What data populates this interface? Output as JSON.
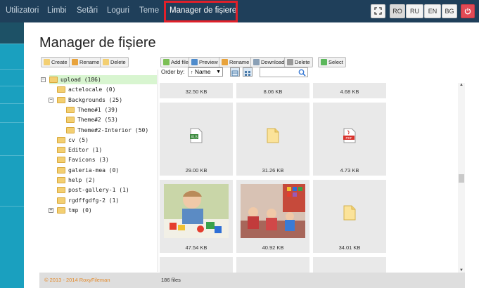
{
  "nav": {
    "items": [
      "Utilizatori",
      "Limbi",
      "Setări",
      "Loguri",
      "Teme",
      "Manager de fișiere"
    ],
    "languages": [
      "RO",
      "RU",
      "EN",
      "BG"
    ],
    "selected_language": "RO",
    "expand_icon": "expand-icon",
    "power_icon": "power-icon",
    "colors": {
      "nav_bg": "#1f3f5a",
      "highlight_border": "#e0202a",
      "sidebar": "#1aa0bf"
    }
  },
  "page": {
    "title": "Manager de fișiere"
  },
  "tree_toolbar": {
    "create": "Create",
    "rename": "Rename",
    "delete": "Delete"
  },
  "file_toolbar": {
    "add_file": "Add file",
    "preview": "Preview",
    "rename": "Rename",
    "download": "Download",
    "delete": "Delete",
    "select": "Select",
    "order_by_label": "Order by:",
    "order_by_value": "Name"
  },
  "tree": [
    {
      "label": "upload (186)",
      "level": 0,
      "expander": "−",
      "selected": true
    },
    {
      "label": "actelocale (0)",
      "level": 1
    },
    {
      "label": "Backgrounds (25)",
      "level": 1,
      "expander": "−"
    },
    {
      "label": "Theme#1 (39)",
      "level": 2
    },
    {
      "label": "Theme#2 (53)",
      "level": 2
    },
    {
      "label": "Theme#2-Interior (50)",
      "level": 2
    },
    {
      "label": "cv (5)",
      "level": 1
    },
    {
      "label": "Editor (1)",
      "level": 1
    },
    {
      "label": "Favicons (3)",
      "level": 1
    },
    {
      "label": "galeria-mea (0)",
      "level": 1
    },
    {
      "label": "help (2)",
      "level": 1
    },
    {
      "label": "post-gallery-1 (1)",
      "level": 1
    },
    {
      "label": "rgdffgdfg-2 (1)",
      "level": 1
    },
    {
      "label": "tmp (0)",
      "level": 1,
      "expander": "+"
    }
  ],
  "files": [
    {
      "size": "32.50 KB"
    },
    {
      "size": "8.06 KB"
    },
    {
      "size": "4.68 KB"
    },
    {
      "size": "29.00 KB",
      "icon": "xls-file-icon",
      "label": "XLS"
    },
    {
      "size": "31.26 KB",
      "icon": "document-file-icon"
    },
    {
      "size": "4.73 KB",
      "icon": "pdf-file-icon",
      "label": "PDF"
    },
    {
      "size": "47.54 KB",
      "icon": "photo-child-thumbnail"
    },
    {
      "size": "40.92 KB",
      "icon": "photo-group-thumbnail"
    },
    {
      "size": "34.01 KB",
      "icon": "document-file-icon"
    }
  ],
  "footer": {
    "copyright": "© 2013 - 2014 RoxyFileman",
    "count": "186 files"
  }
}
